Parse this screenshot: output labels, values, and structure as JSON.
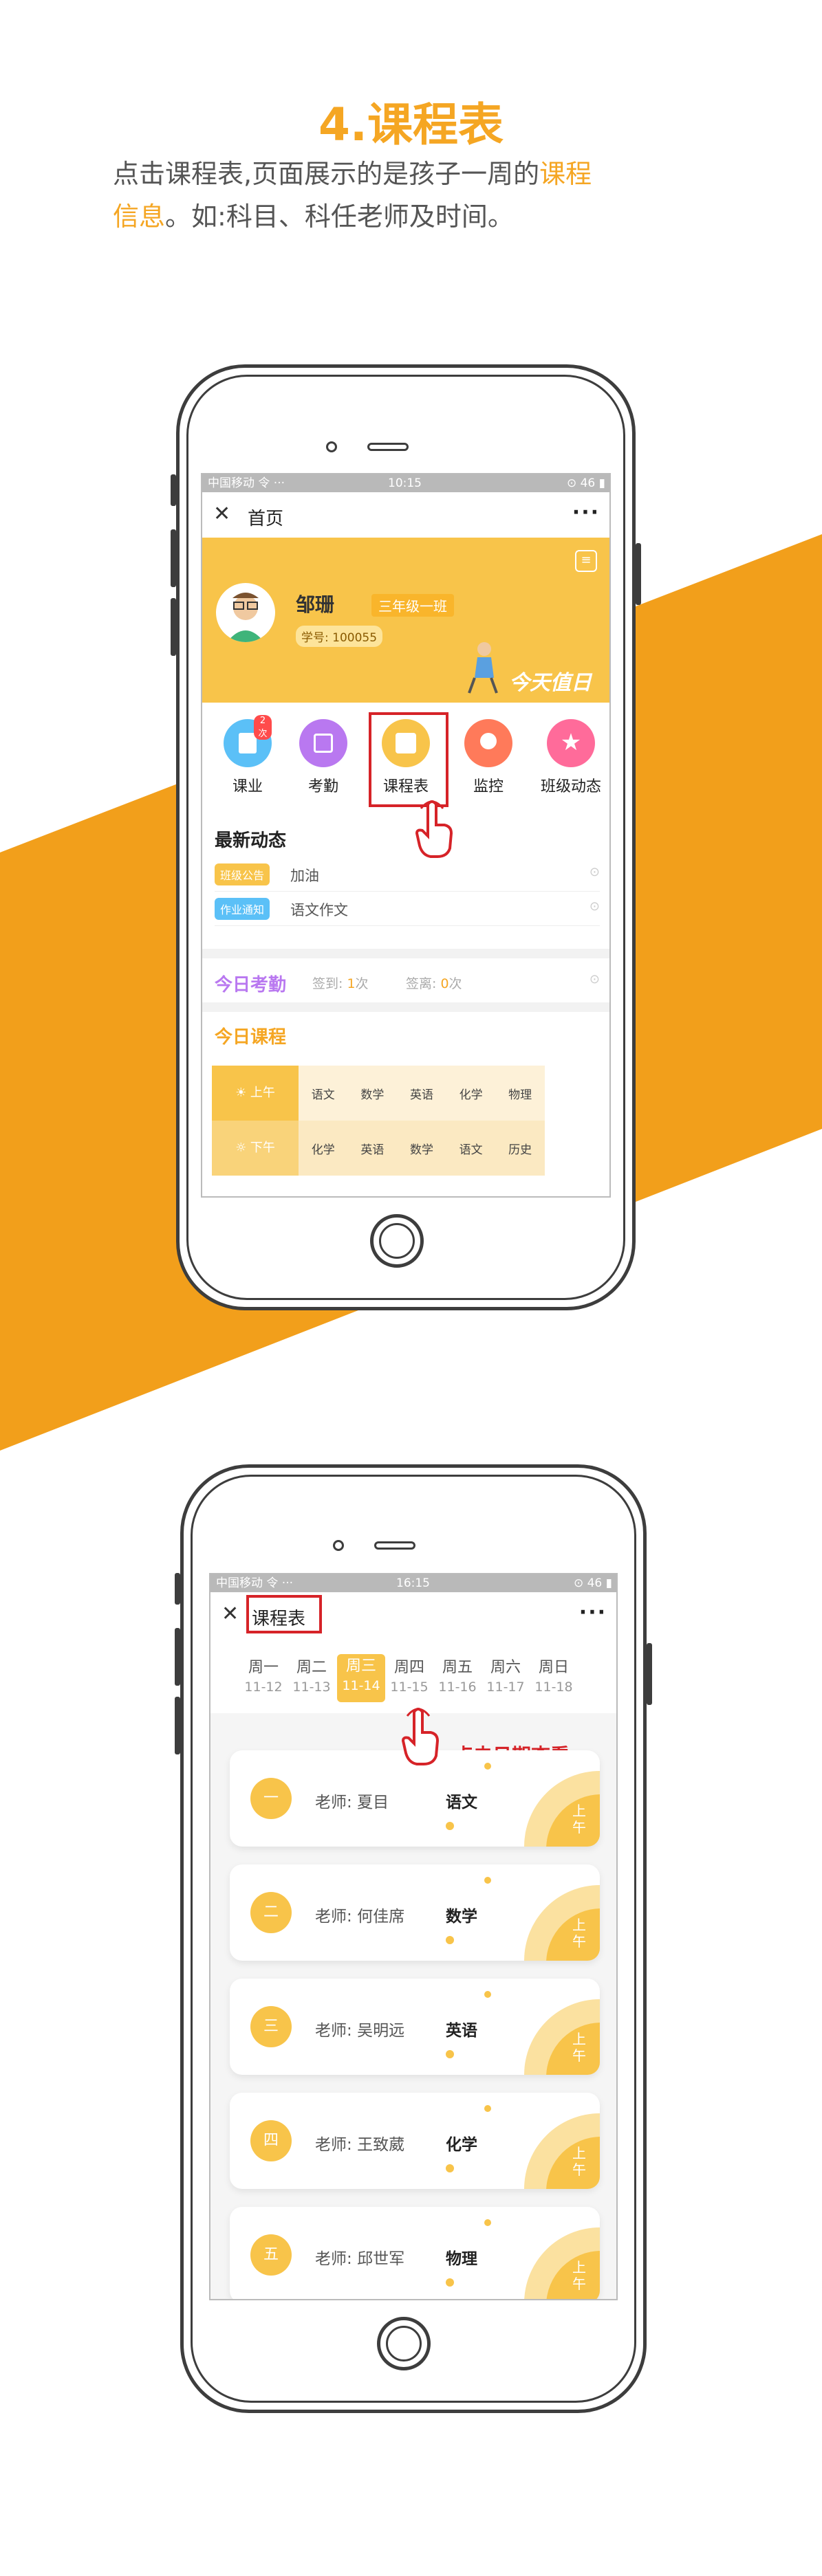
{
  "header": {
    "title": "4.课程表",
    "desc_1": "点击课程表,页面展示的是孩子一周的",
    "desc_hl_1": "课程",
    "desc_hl_2": "信息",
    "desc_2": "。如:科目、科任老师及时间。"
  },
  "colors": {
    "accent": "#f5a623",
    "card_yellow": "#f8c44a",
    "highlight_red": "#d62328"
  },
  "phone1": {
    "status": {
      "carrier": "中国移动 令 ···",
      "time": "10:15",
      "right": "⊙ 46 ▮"
    },
    "nav": {
      "close_icon": "close-icon",
      "title": "首页",
      "more": "···"
    },
    "profile": {
      "name": "邹珊",
      "class": "三年级一班",
      "student_id": "学号: 100055",
      "banner": "今天值日"
    },
    "quick": [
      {
        "label": "课业",
        "badge": "2次",
        "color": "#5bc0f7",
        "icon": "book-icon"
      },
      {
        "label": "考勤",
        "color": "#b978f0",
        "icon": "calendar-icon"
      },
      {
        "label": "课程表",
        "color": "#f8c44a",
        "icon": "schedule-icon"
      },
      {
        "label": "监控",
        "color": "#ff7a5a",
        "icon": "camera-icon"
      },
      {
        "label": "班级动态",
        "color": "#ff6b9a",
        "icon": "star-icon"
      }
    ],
    "news": {
      "title": "最新动态",
      "items": [
        {
          "tag": "班级公告",
          "text": "加油"
        },
        {
          "tag": "作业通知",
          "text": "语文作文"
        }
      ]
    },
    "attendance": {
      "title": "今日考勤",
      "sign_in_label": "签到:",
      "sign_in_value": "1",
      "sign_in_unit": "次",
      "sign_out_label": "签离:",
      "sign_out_value": "0",
      "sign_out_unit": "次"
    },
    "today": {
      "title": "今日课程",
      "am_label": "上午",
      "pm_label": "下午",
      "am": [
        "语文",
        "数学",
        "英语",
        "化学",
        "物理"
      ],
      "pm": [
        "化学",
        "英语",
        "数学",
        "语文",
        "历史"
      ]
    }
  },
  "phone2": {
    "status": {
      "carrier": "中国移动 令 ···",
      "time": "16:15",
      "right": "⊙ 46 ▮"
    },
    "nav": {
      "title": "课程表",
      "more": "···"
    },
    "days": [
      {
        "name": "周一",
        "date": "11-12"
      },
      {
        "name": "周二",
        "date": "11-13"
      },
      {
        "name": "周三",
        "date": "11-14",
        "active": true
      },
      {
        "name": "周四",
        "date": "11-15"
      },
      {
        "name": "周五",
        "date": "11-16"
      },
      {
        "name": "周六",
        "date": "11-17"
      },
      {
        "name": "周日",
        "date": "11-18"
      }
    ],
    "hint": "点击日期查看",
    "teacher_label": "老师:",
    "period": "上午",
    "lessons": [
      {
        "num": "一",
        "teacher": "夏目",
        "subject": "语文"
      },
      {
        "num": "二",
        "teacher": "何佳席",
        "subject": "数学"
      },
      {
        "num": "三",
        "teacher": "吴明远",
        "subject": "英语"
      },
      {
        "num": "四",
        "teacher": "王致葳",
        "subject": "化学"
      },
      {
        "num": "五",
        "teacher": "邱世军",
        "subject": "物理"
      }
    ]
  }
}
